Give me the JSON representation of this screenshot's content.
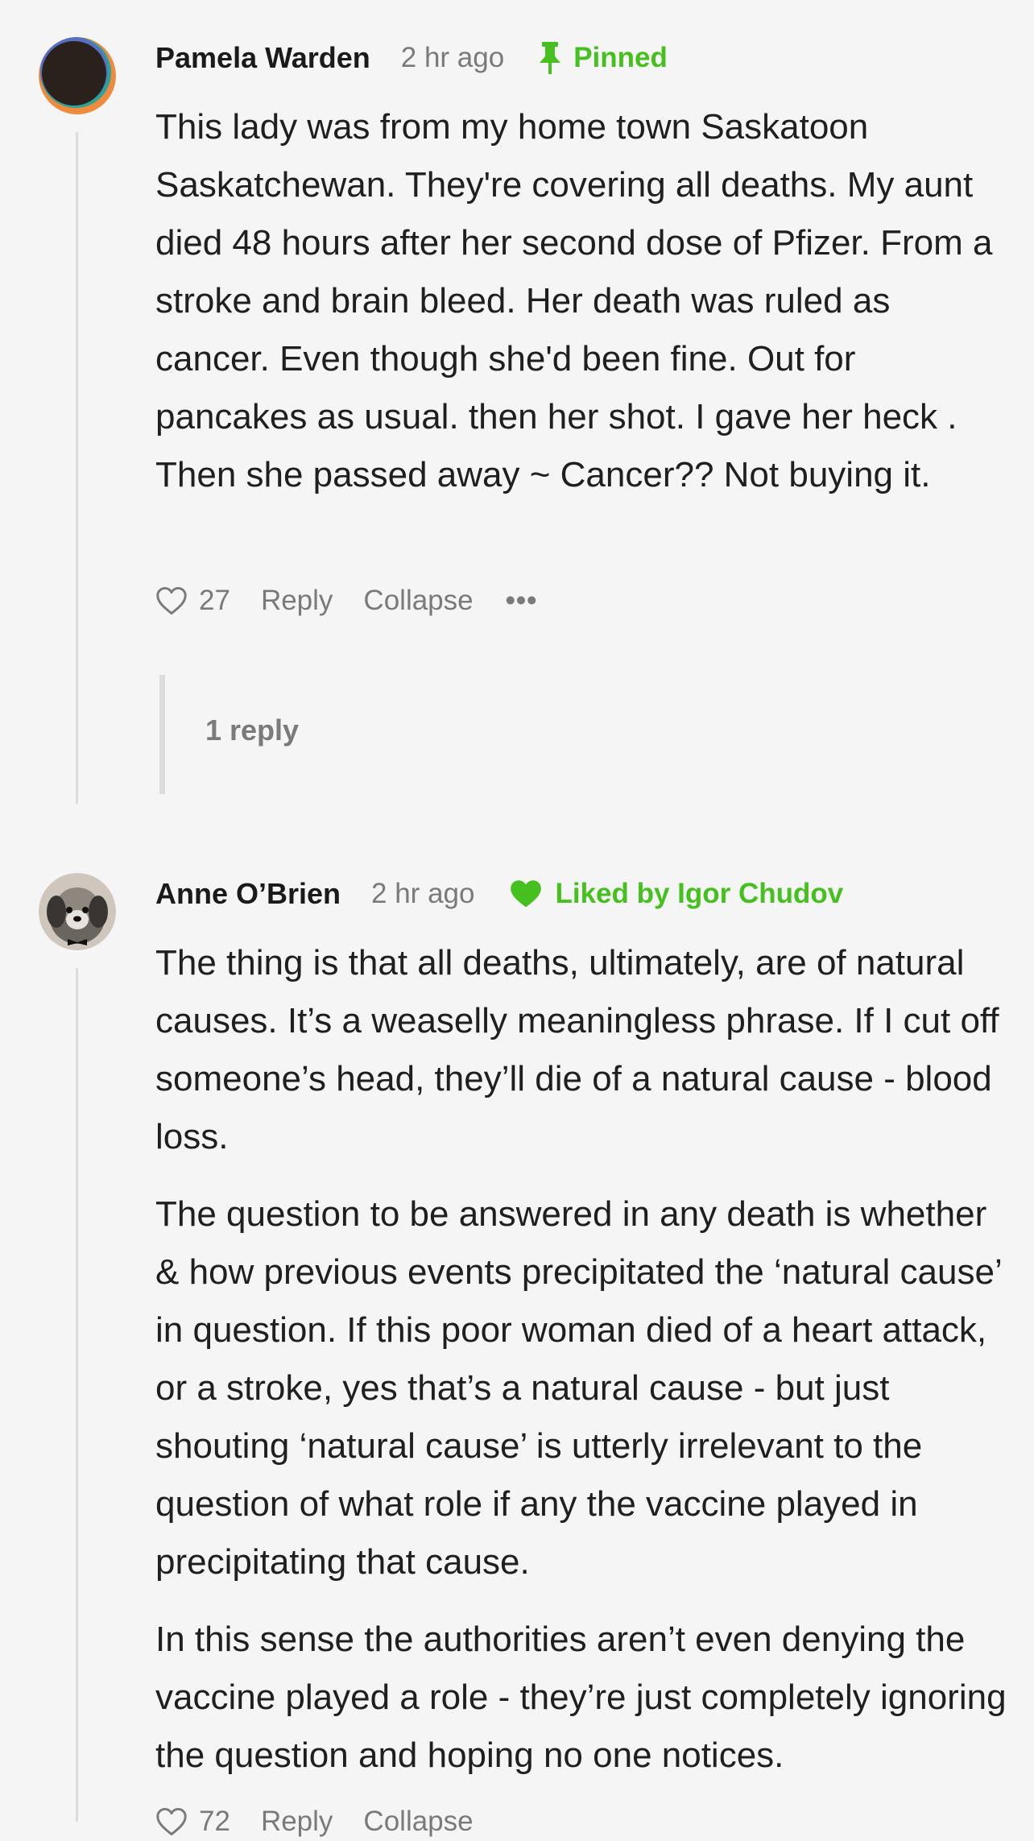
{
  "comments": [
    {
      "author": "Pamela Warden",
      "time": "2 hr ago",
      "badge": "Pinned",
      "paragraphs": [
        "This lady was from my home town Saskatoon Saskatchewan. They're covering all deaths. My aunt died 48 hours after her second dose of Pfizer. From a stroke and brain bleed. Her death was ruled as cancer. Even though she'd been fine. Out for pancakes as usual. then her shot. I gave her heck . Then she passed away ~ Cancer?? Not buying it."
      ],
      "likes": "27",
      "reply_label": "Reply",
      "collapse_label": "Collapse",
      "more_label": "•••",
      "replies_label": "1 reply"
    },
    {
      "author": "Anne O’Brien",
      "time": "2 hr ago",
      "badge": "Liked by Igor Chudov",
      "paragraphs": [
        "The thing is that all deaths, ultimately, are of natural causes. It’s a weaselly meaningless phrase. If I cut off someone’s head, they’ll die of a natural cause - blood loss.",
        "The question to be answered in any death is whether & how previous events precipitated the ‘natural cause’ in question. If this poor woman died of a heart attack, or a stroke, yes that’s a natural cause - but just shouting ‘natural cause’ is utterly irrelevant to the question of what role if any the vaccine played in precipitating that cause.",
        "In this sense the authorities aren’t even denying the vaccine played a role - they’re just completely ignoring the question and hoping no one notices."
      ],
      "likes": "72",
      "reply_label": "Reply",
      "collapse_label": "Collapse"
    }
  ],
  "colors": {
    "background": "#f5f5f5",
    "accent_green": "#45c01f",
    "muted_text": "#7a7a7a",
    "thread_line": "#dcdcdc"
  },
  "icons": {
    "pinned": "pin-icon",
    "liked": "heart-filled-icon",
    "like_action": "heart-outline-icon",
    "more": "more-icon"
  }
}
